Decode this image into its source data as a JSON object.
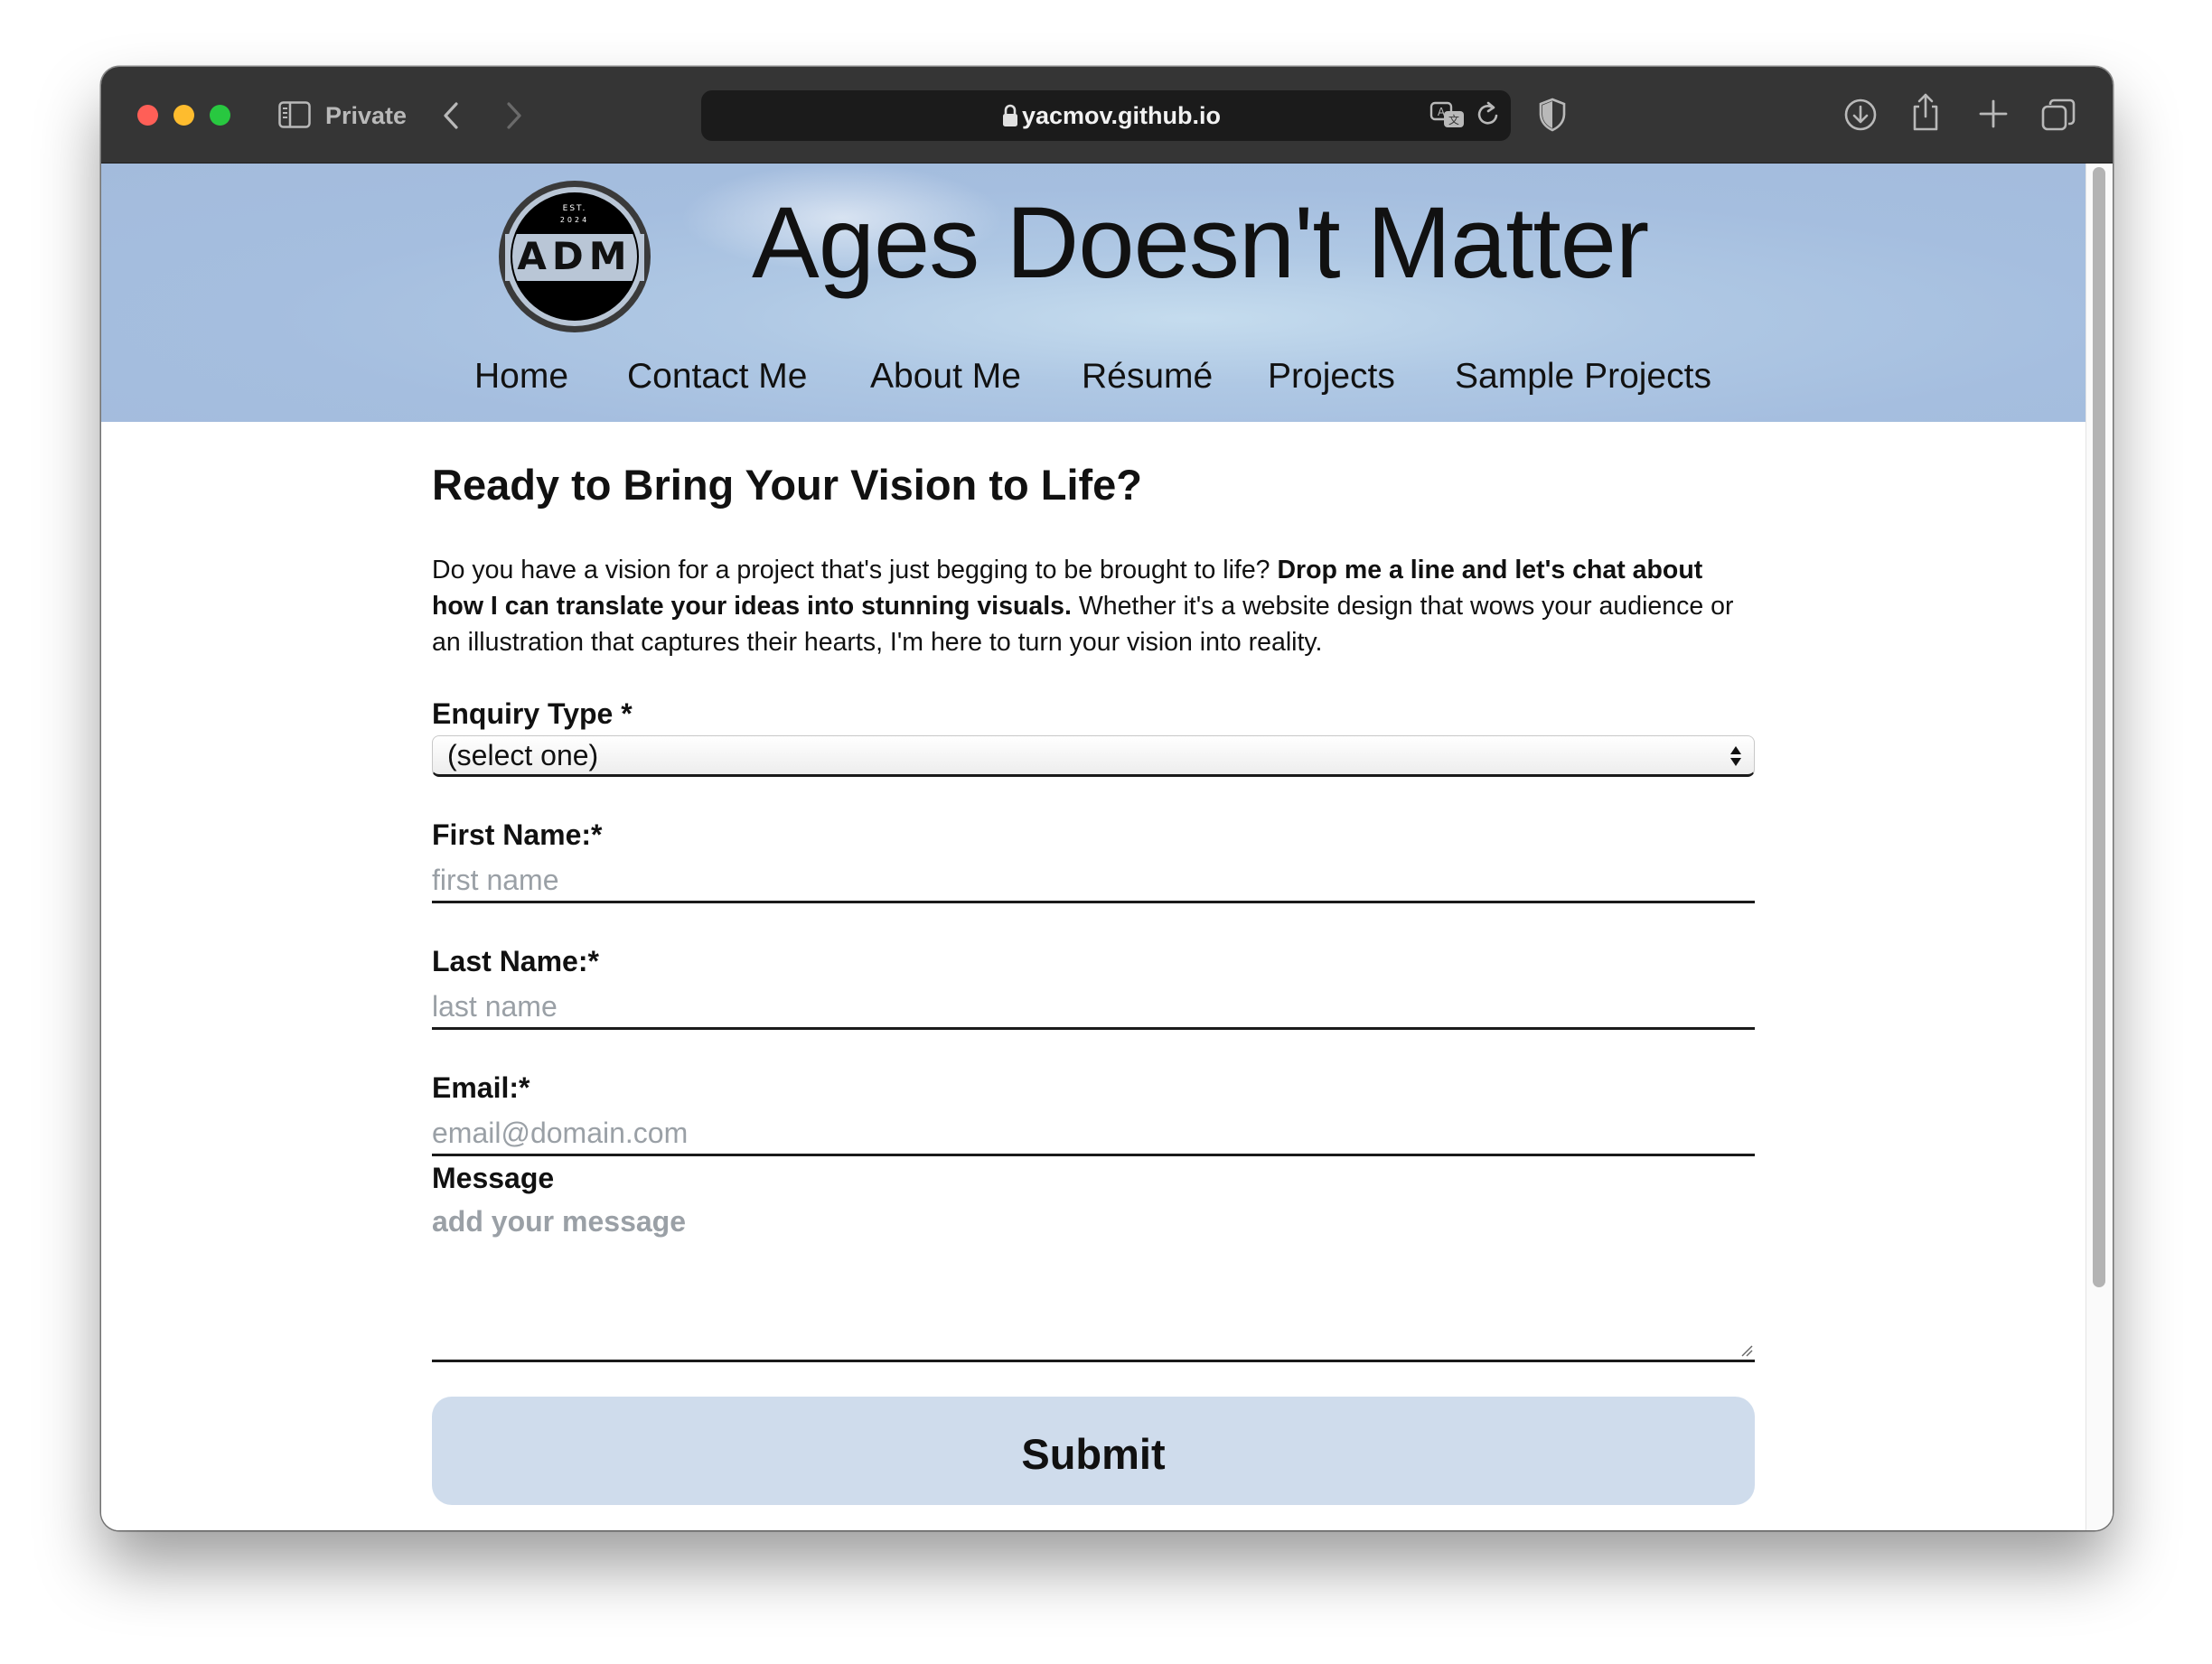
{
  "browser": {
    "mode_label": "Private",
    "url": "yacmov.github.io"
  },
  "site": {
    "title": "Ages Doesn't Matter",
    "logo": {
      "text": "ADM",
      "est": "EST.",
      "year": "2024"
    },
    "nav": [
      "Home",
      "Contact Me",
      "About Me",
      "Résumé",
      "Projects",
      "Sample Projects"
    ]
  },
  "page": {
    "heading": "Ready to Bring Your Vision to Life?",
    "intro_part1": "Do you have a vision for a project that's just begging to be brought to life? ",
    "intro_bold": "Drop me a line and let's chat about how I can translate your ideas into stunning visuals.",
    "intro_part2": " Whether it's a website design that wows your audience or an illustration that captures their hearts, I'm here to turn your vision into reality."
  },
  "form": {
    "enquiry_label": "Enquiry Type *",
    "enquiry_value": "(select one)",
    "first_name_label": "First Name:*",
    "first_name_placeholder": "first name",
    "last_name_label": "Last Name:*",
    "last_name_placeholder": "last name",
    "email_label": "Email:*",
    "email_placeholder": "email@domain.com",
    "message_label": "Message",
    "message_placeholder": "add your message",
    "submit_label": "Submit"
  },
  "colors": {
    "hero_bg": "#a5bedf",
    "submit_bg": "#cfdcec",
    "chrome_bg": "#353535"
  }
}
